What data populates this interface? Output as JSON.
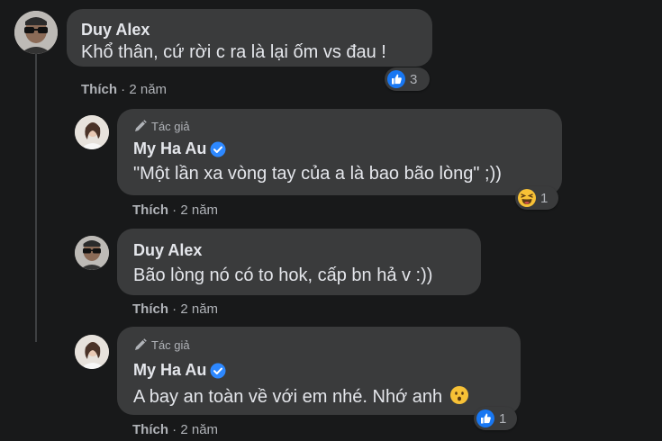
{
  "comments": [
    {
      "author": "Duy Alex",
      "text": "Khổ thân, cứ rời c ra là lại ốm vs đau !",
      "like_label": "Thích",
      "time": "2 năm",
      "reaction": {
        "icon": "like-icon",
        "count": "3"
      }
    },
    {
      "badge": "Tác giả",
      "author": "My Ha Au",
      "text": "\"Một lần xa vòng tay của a là bao bão lòng\" ;))",
      "like_label": "Thích",
      "time": "2 năm",
      "reaction": {
        "icon": "laugh-emoji-icon",
        "count": "1"
      }
    },
    {
      "author": "Duy Alex",
      "text": "Bão lòng nó có to hok, cấp bn hả v :))",
      "like_label": "Thích",
      "time": "2 năm"
    },
    {
      "badge": "Tác giả",
      "author": "My Ha Au",
      "text": "A bay an toàn về với em nhé. Nhớ anh",
      "emoji": "hushed-emoji-icon",
      "like_label": "Thích",
      "time": "2 năm",
      "reaction": {
        "icon": "like-icon",
        "count": "1"
      }
    }
  ],
  "separator": " · ",
  "colors": {
    "background": "#18191a",
    "bubble": "#3a3b3c",
    "text": "#e4e6eb",
    "secondary": "#b0b3b8",
    "like_blue": "#1877f2",
    "verified_blue": "#2d88ff"
  }
}
